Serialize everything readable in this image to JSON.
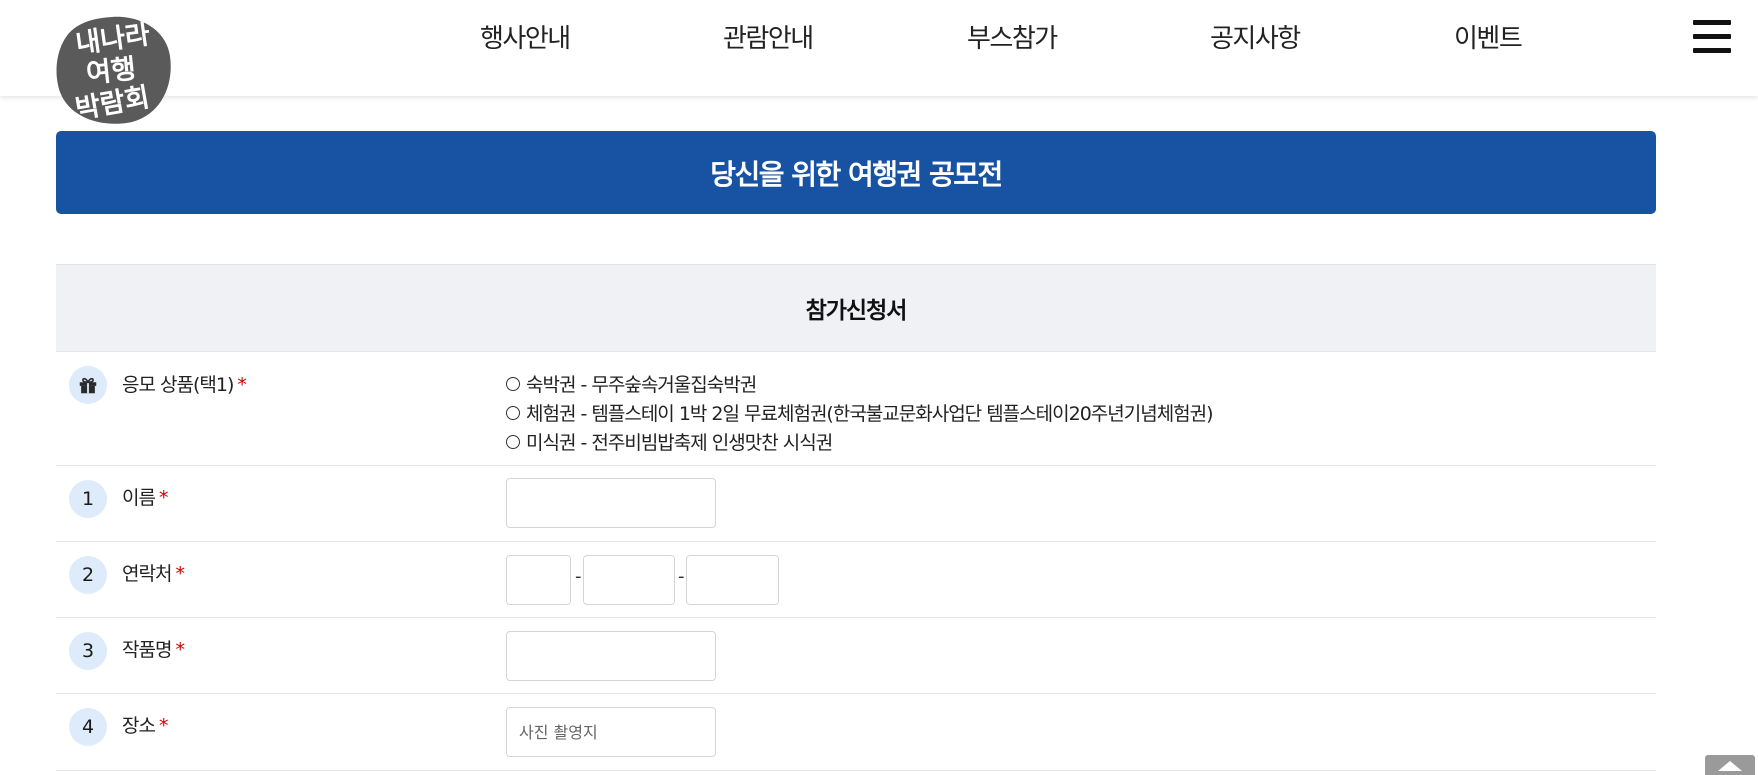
{
  "logo": {
    "alt": "내나라 여행 박람회",
    "lines": [
      "내나라",
      "여행",
      "박람회"
    ],
    "color": "#5a5a5a"
  },
  "nav": {
    "items": [
      "행사안내",
      "관람안내",
      "부스참가",
      "공지사항",
      "이벤트"
    ],
    "menu_icon": "hamburger-menu-icon"
  },
  "banner": {
    "title": "당신을 위한 여행권 공모전",
    "color": "#1853a3"
  },
  "form": {
    "title": "참가신청서",
    "prize": {
      "icon": "gift-icon",
      "label": "응모 상품(택1)",
      "required_mark": "*",
      "options": [
        "숙박권 - 무주숲속거울집숙박권",
        "체험권 - 템플스테이 1박 2일 무료체험권(한국불교문화사업단 템플스테이20주년기념체험권)",
        "미식권 - 전주비빔밥축제 인생맛찬 시식권"
      ]
    },
    "fields": [
      {
        "number": "1",
        "label": "이름",
        "required_mark": "*",
        "value": "",
        "placeholder": ""
      },
      {
        "number": "2",
        "label": "연락처",
        "required_mark": "*",
        "parts": [
          "",
          "",
          ""
        ],
        "separator": "-"
      },
      {
        "number": "3",
        "label": "작품명",
        "required_mark": "*",
        "value": "",
        "placeholder": ""
      },
      {
        "number": "4",
        "label": "장소",
        "required_mark": "*",
        "value": "",
        "placeholder": "사진 촬영지"
      }
    ]
  },
  "scroll_top": {
    "icon": "arrow-up-icon"
  }
}
